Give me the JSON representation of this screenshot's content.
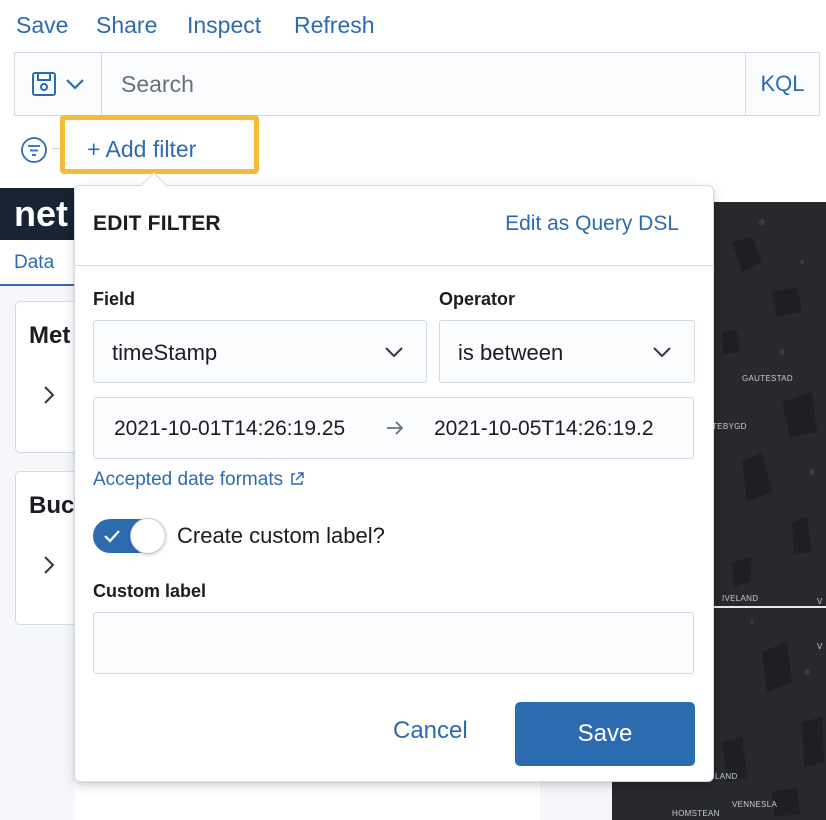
{
  "top_nav": {
    "save": "Save",
    "share": "Share",
    "inspect": "Inspect",
    "refresh": "Refresh"
  },
  "query_bar": {
    "search_placeholder": "Search",
    "language": "KQL"
  },
  "filter_bar": {
    "add_filter": "+ Add filter"
  },
  "background": {
    "app_title": "net",
    "tab_data": "Data",
    "card_metrics": "Met",
    "card_buckets": "Buc",
    "map_labels": [
      "GAUTESTAD",
      "TEBYGD",
      "IVELAND",
      "V",
      "V",
      "LAND",
      "VENNESLA",
      "HOMSTEAN"
    ]
  },
  "popover": {
    "title": "EDIT FILTER",
    "edit_dsl": "Edit as Query DSL",
    "field_label": "Field",
    "field_value": "timeStamp",
    "operator_label": "Operator",
    "operator_value": "is between",
    "range_start": "2021-10-01T14:26:19.25",
    "range_end": "2021-10-05T14:26:19.2",
    "accepted_formats": "Accepted date formats",
    "custom_label_toggle": "Create custom label?",
    "custom_label_checked": true,
    "custom_label_title": "Custom label",
    "custom_label_value": "",
    "cancel": "Cancel",
    "save": "Save"
  },
  "colors": {
    "link": "#2d6bb0",
    "highlight": "#f2bb38",
    "primary": "#2d6bb0",
    "map_bg": "#27292d"
  }
}
